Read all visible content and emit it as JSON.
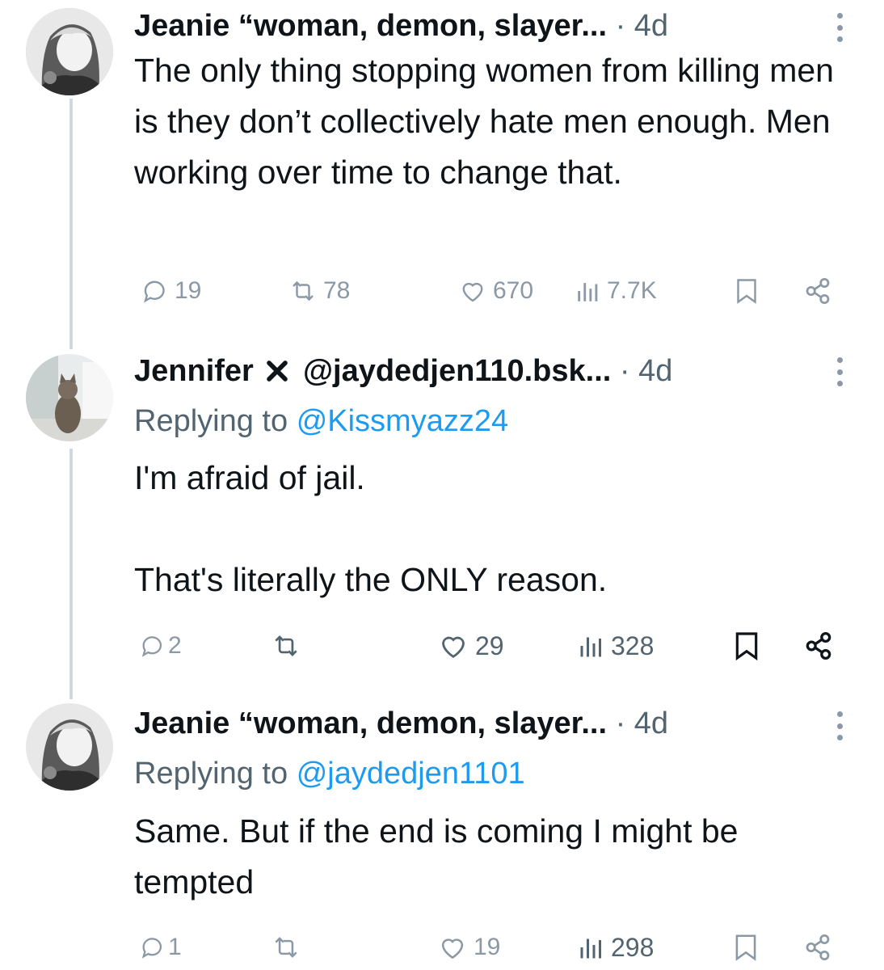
{
  "tweets": [
    {
      "author": "Jeanie “woman, demon, slayer...",
      "time": "4d",
      "text": "The only thing stopping women from killing men is they don’t collectively hate men enough. Men working over time to change that.",
      "stats": {
        "replies": "19",
        "reposts": "78",
        "likes": "670",
        "views": "7.7K"
      }
    },
    {
      "author": "Jennifer",
      "handle": "@jaydedjen110.bsk...",
      "time": "4d",
      "replying_label": "Replying to",
      "replying_handle": "@Kissmyazz24",
      "text": "I'm afraid of jail.\n\nThat's literally the ONLY reason.",
      "stats": {
        "replies": "2",
        "reposts": "",
        "likes": "29",
        "views": "328"
      }
    },
    {
      "author": "Jeanie “woman, demon, slayer...",
      "time": "4d",
      "replying_label": "Replying to",
      "replying_handle": "@jaydedjen1101",
      "text": "Same. But if the end is coming I might be tempted",
      "stats": {
        "replies": "1",
        "reposts": "",
        "likes": "19",
        "views": "298"
      }
    }
  ],
  "separator": "·",
  "colors": {
    "text": "#0f1419",
    "muted": "#536471",
    "link": "#1d9bf0",
    "thread": "#cfd9de"
  },
  "icons": [
    "reply-icon",
    "repost-icon",
    "like-icon",
    "views-icon",
    "bookmark-icon",
    "share-icon",
    "more-icon",
    "x-mark-icon"
  ]
}
